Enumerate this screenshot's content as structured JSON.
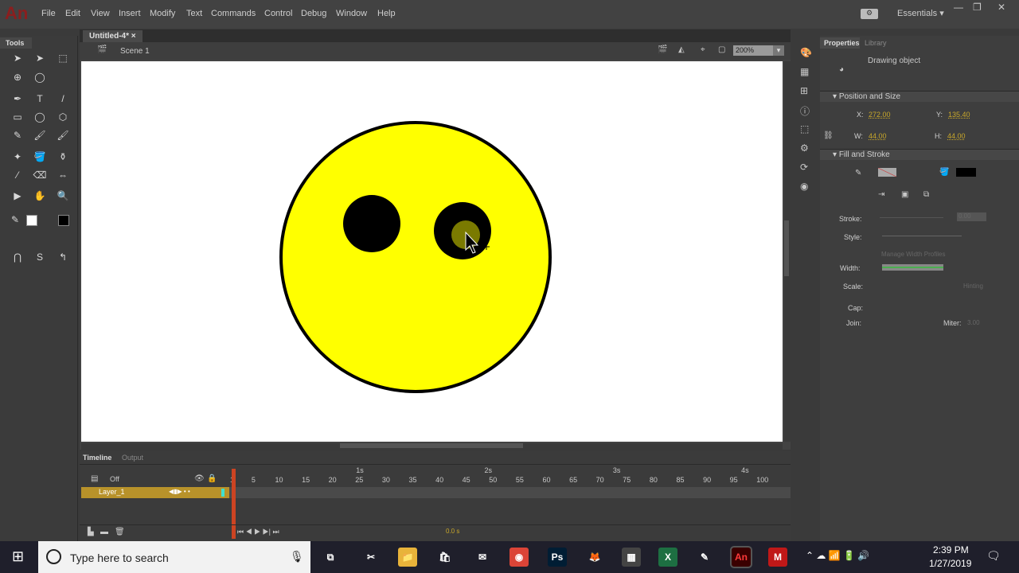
{
  "app": {
    "logo": "An",
    "menus": [
      "File",
      "Edit",
      "View",
      "Insert",
      "Modify",
      "Text",
      "Commands",
      "Control",
      "Debug",
      "Window",
      "Help"
    ],
    "workspace": "Essentials",
    "window_controls": [
      "minimize",
      "restore",
      "close"
    ]
  },
  "document": {
    "tab": "Untitled-4*",
    "scene": "Scene 1",
    "zoom": "200%"
  },
  "tools": {
    "title": "Tools"
  },
  "stage": {
    "face_color": "#ffff00",
    "stroke_color": "#000000",
    "selection_color": "#7a7a00"
  },
  "timeline": {
    "tabs": [
      "Timeline",
      "Output"
    ],
    "onion": "Off",
    "layer": "Layer_1",
    "frame_numbers": [
      1,
      5,
      10,
      15,
      20,
      25,
      30,
      35,
      40,
      45,
      50,
      55,
      60,
      65,
      70,
      75,
      80,
      85,
      90,
      95,
      100
    ],
    "seconds": [
      "1s",
      "2s",
      "3s",
      "4s"
    ],
    "fps": "0.0 s",
    "current_frame": 1
  },
  "properties": {
    "tabs": [
      "Properties",
      "Library"
    ],
    "object_type": "Drawing object",
    "position_size": {
      "title": "Position and Size",
      "x_label": "X:",
      "x": "272.00",
      "y_label": "Y:",
      "y": "135.40",
      "w_label": "W:",
      "w": "44.00",
      "h_label": "H:",
      "h": "44.00"
    },
    "fill_stroke": {
      "title": "Fill and Stroke",
      "fill_color": "#000000",
      "stroke_label": "Stroke:",
      "stroke_value": "0.00",
      "style_label": "Style:",
      "manage_label": "Manage Width Profiles",
      "width_label": "Width:",
      "scale_label": "Scale:",
      "hinting": "Hinting",
      "cap_label": "Cap:",
      "join_label": "Join:",
      "miter_label": "Miter:",
      "miter_value": "3.00"
    }
  },
  "taskbar": {
    "search_placeholder": "Type here to search",
    "time": "2:39 PM",
    "date": "1/27/2019"
  }
}
